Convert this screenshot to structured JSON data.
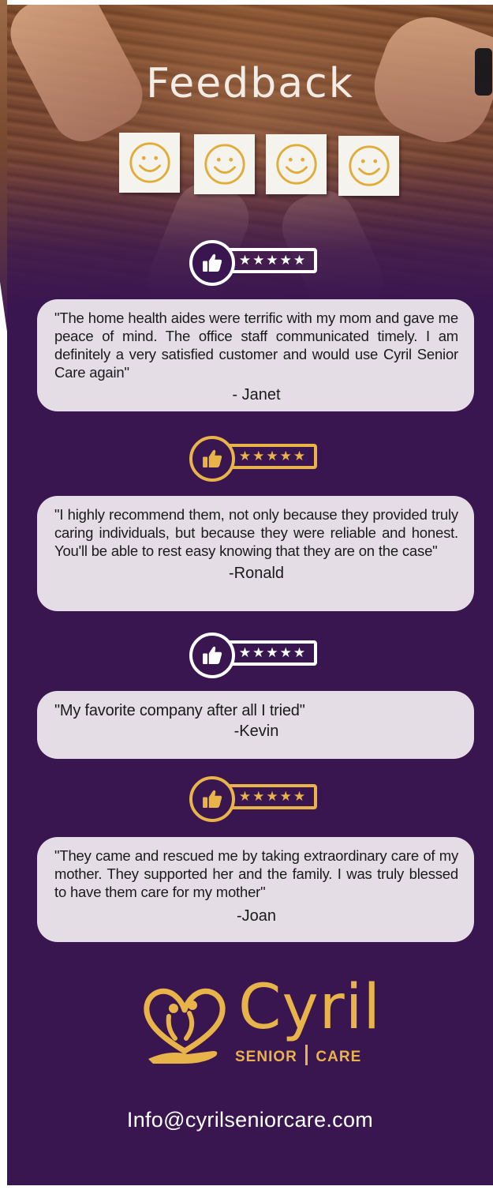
{
  "header": {
    "title": "Feedback",
    "smiley_count": 4
  },
  "ratings": [
    {
      "stars": "★★★★★",
      "style": "white",
      "rating": 5
    },
    {
      "stars": "★★★★★",
      "style": "gold",
      "rating": 5
    },
    {
      "stars": "★★★★★",
      "style": "white",
      "rating": 5
    },
    {
      "stars": "★★★★★",
      "style": "gold",
      "rating": 5
    }
  ],
  "reviews": [
    {
      "quote": "\"The home health aides were terrific with my mom and gave me peace of mind.  The office staff communicated timely.  I am definitely a very satisfied customer and would use Cyril Senior Care again\"",
      "author": "- Janet"
    },
    {
      "quote": "\"I highly recommend them, not only because they provided truly caring individuals, but because they were reliable and honest.  You'll be able to rest easy knowing that they are on the case\"",
      "author": "-Ronald"
    },
    {
      "quote": "\"My favorite company after all I tried\"",
      "author": "-Kevin"
    },
    {
      "quote": "\"They came and rescued me by taking extraordinary care of my mother. They supported her and the family. I was truly blessed to have them care for my mother\"",
      "author": "-Joan"
    }
  ],
  "brand": {
    "name": "Cyril",
    "subtitle_left": "SENIOR",
    "subtitle_right": "CARE",
    "email": "Info@cyrilseniorcare.com"
  },
  "colors": {
    "background": "#3a1650",
    "gold": "#e8b44a",
    "card": "#e4dde6",
    "white": "#ffffff"
  },
  "icons": {
    "rating_badge": "thumbs-up-icon",
    "card": "smiley-face-icon",
    "logo": "heart-hand-icon"
  }
}
